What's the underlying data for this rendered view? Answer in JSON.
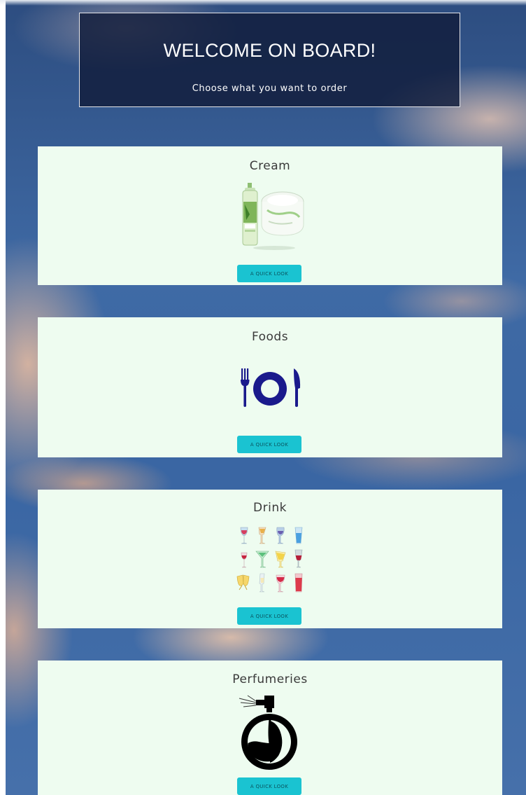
{
  "header": {
    "title": "WELCOME ON BOARD!",
    "subtitle": "Choose what you want to order"
  },
  "categories": [
    {
      "title": "Cream",
      "icon": "cream-bottles-icon",
      "button_label": "A QUICK LOOK"
    },
    {
      "title": "Foods",
      "icon": "plate-fork-knife-icon",
      "button_label": "A QUICK LOOK"
    },
    {
      "title": "Drink",
      "icon": "drink-glasses-icon",
      "button_label": "A QUICK LOOK"
    },
    {
      "title": "Perfumeries",
      "icon": "perfume-bottle-icon",
      "button_label": "A QUICK LOOK"
    }
  ],
  "colors": {
    "card_background": "#eefcf0",
    "button_background": "#1ac3d1",
    "header_background": "#111c3a",
    "plate_icon": "#1a1a8c"
  }
}
